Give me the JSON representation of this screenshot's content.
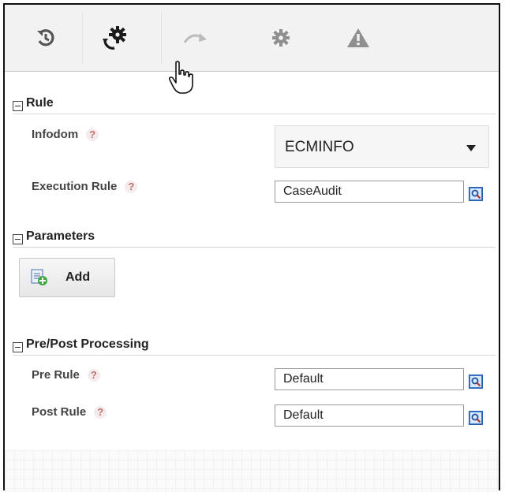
{
  "toolbar": {
    "items": [
      {
        "icon": "history-icon",
        "label": ""
      },
      {
        "icon": "run-gear-icon",
        "label": ""
      },
      {
        "icon": "redo-arrow-icon",
        "label": ""
      },
      {
        "icon": "settings-gear-icon",
        "label": ""
      },
      {
        "icon": "warning-icon",
        "label": ""
      }
    ]
  },
  "sections": {
    "rule": {
      "title": "Rule",
      "infodom_label": "Infodom",
      "infodom_value": "ECMINFO",
      "execution_rule_label": "Execution Rule",
      "execution_rule_value": "CaseAudit"
    },
    "parameters": {
      "title": "Parameters",
      "add_label": "Add"
    },
    "prepost": {
      "title": "Pre/Post Processing",
      "pre_rule_label": "Pre Rule",
      "pre_rule_value": "Default",
      "post_rule_label": "Post Rule",
      "post_rule_value": "Default"
    }
  },
  "help_glyph": "?",
  "colors": {
    "toolbar_bg": "#f2f2f2",
    "help_icon": "#c07070",
    "lookup_blue": "#3a7bd5"
  }
}
